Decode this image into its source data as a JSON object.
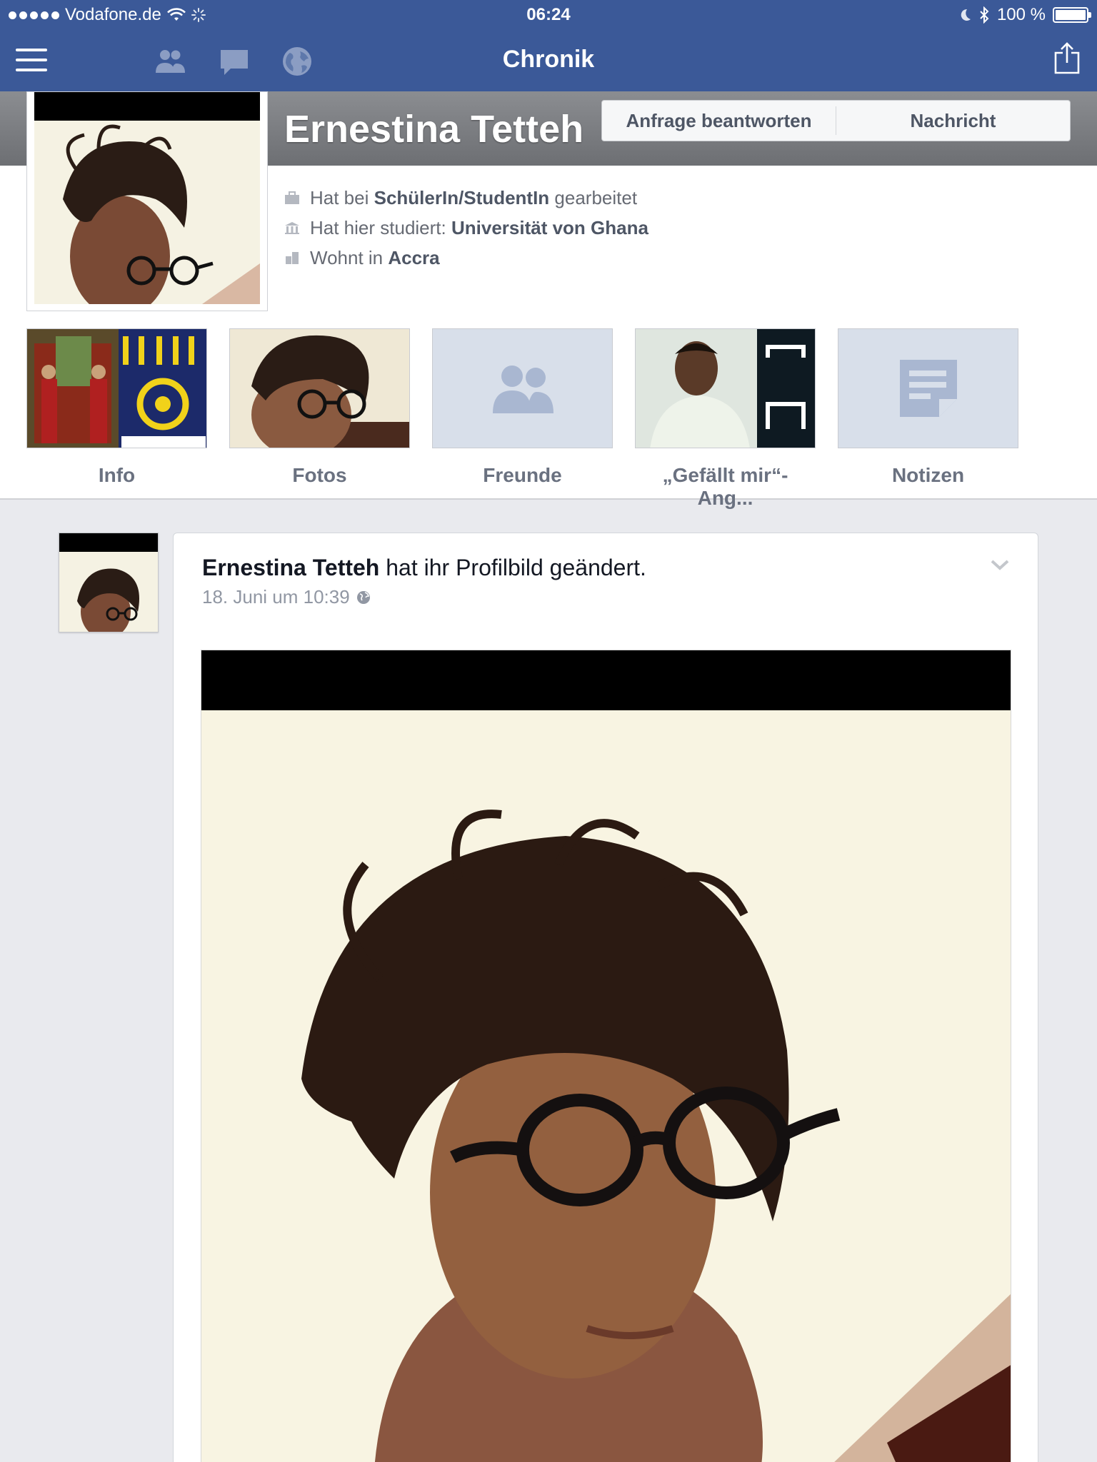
{
  "status_bar": {
    "carrier": "Vodafone.de",
    "time": "06:24",
    "battery_percent": "100 %",
    "battery_level": 1.0
  },
  "nav": {
    "title": "Chronik",
    "icons": [
      "menu-icon",
      "friend-requests-icon",
      "messages-icon",
      "notifications-globe-icon",
      "share-icon"
    ]
  },
  "profile": {
    "name": "Ernestina Tetteh",
    "buttons": {
      "respond": "Anfrage beantworten",
      "message": "Nachricht"
    },
    "info": [
      {
        "prefix": "Hat bei ",
        "value": "SchülerIn/StudentIn",
        "suffix": " gearbeitet",
        "icon": "work-icon"
      },
      {
        "prefix": "Hat hier studiert: ",
        "value": "Universität von Ghana",
        "suffix": "",
        "icon": "education-icon"
      },
      {
        "prefix": "Wohnt in ",
        "value": "Accra",
        "suffix": "",
        "icon": "home-icon"
      }
    ],
    "tiles": [
      {
        "label": "Info"
      },
      {
        "label": "Fotos"
      },
      {
        "label": "Freunde"
      },
      {
        "label": "„Gefällt mir“-Ang..."
      },
      {
        "label": "Notizen"
      }
    ]
  },
  "post": {
    "author": "Ernestina Tetteh",
    "action": " hat ihr Profilbild geändert.",
    "timestamp": "18. Juni um 10:39",
    "privacy_icon": "globe-icon"
  },
  "colors": {
    "brand": "#3b5998",
    "tile_placeholder": "#d8dfea",
    "feed_bg": "#e9eaee"
  }
}
